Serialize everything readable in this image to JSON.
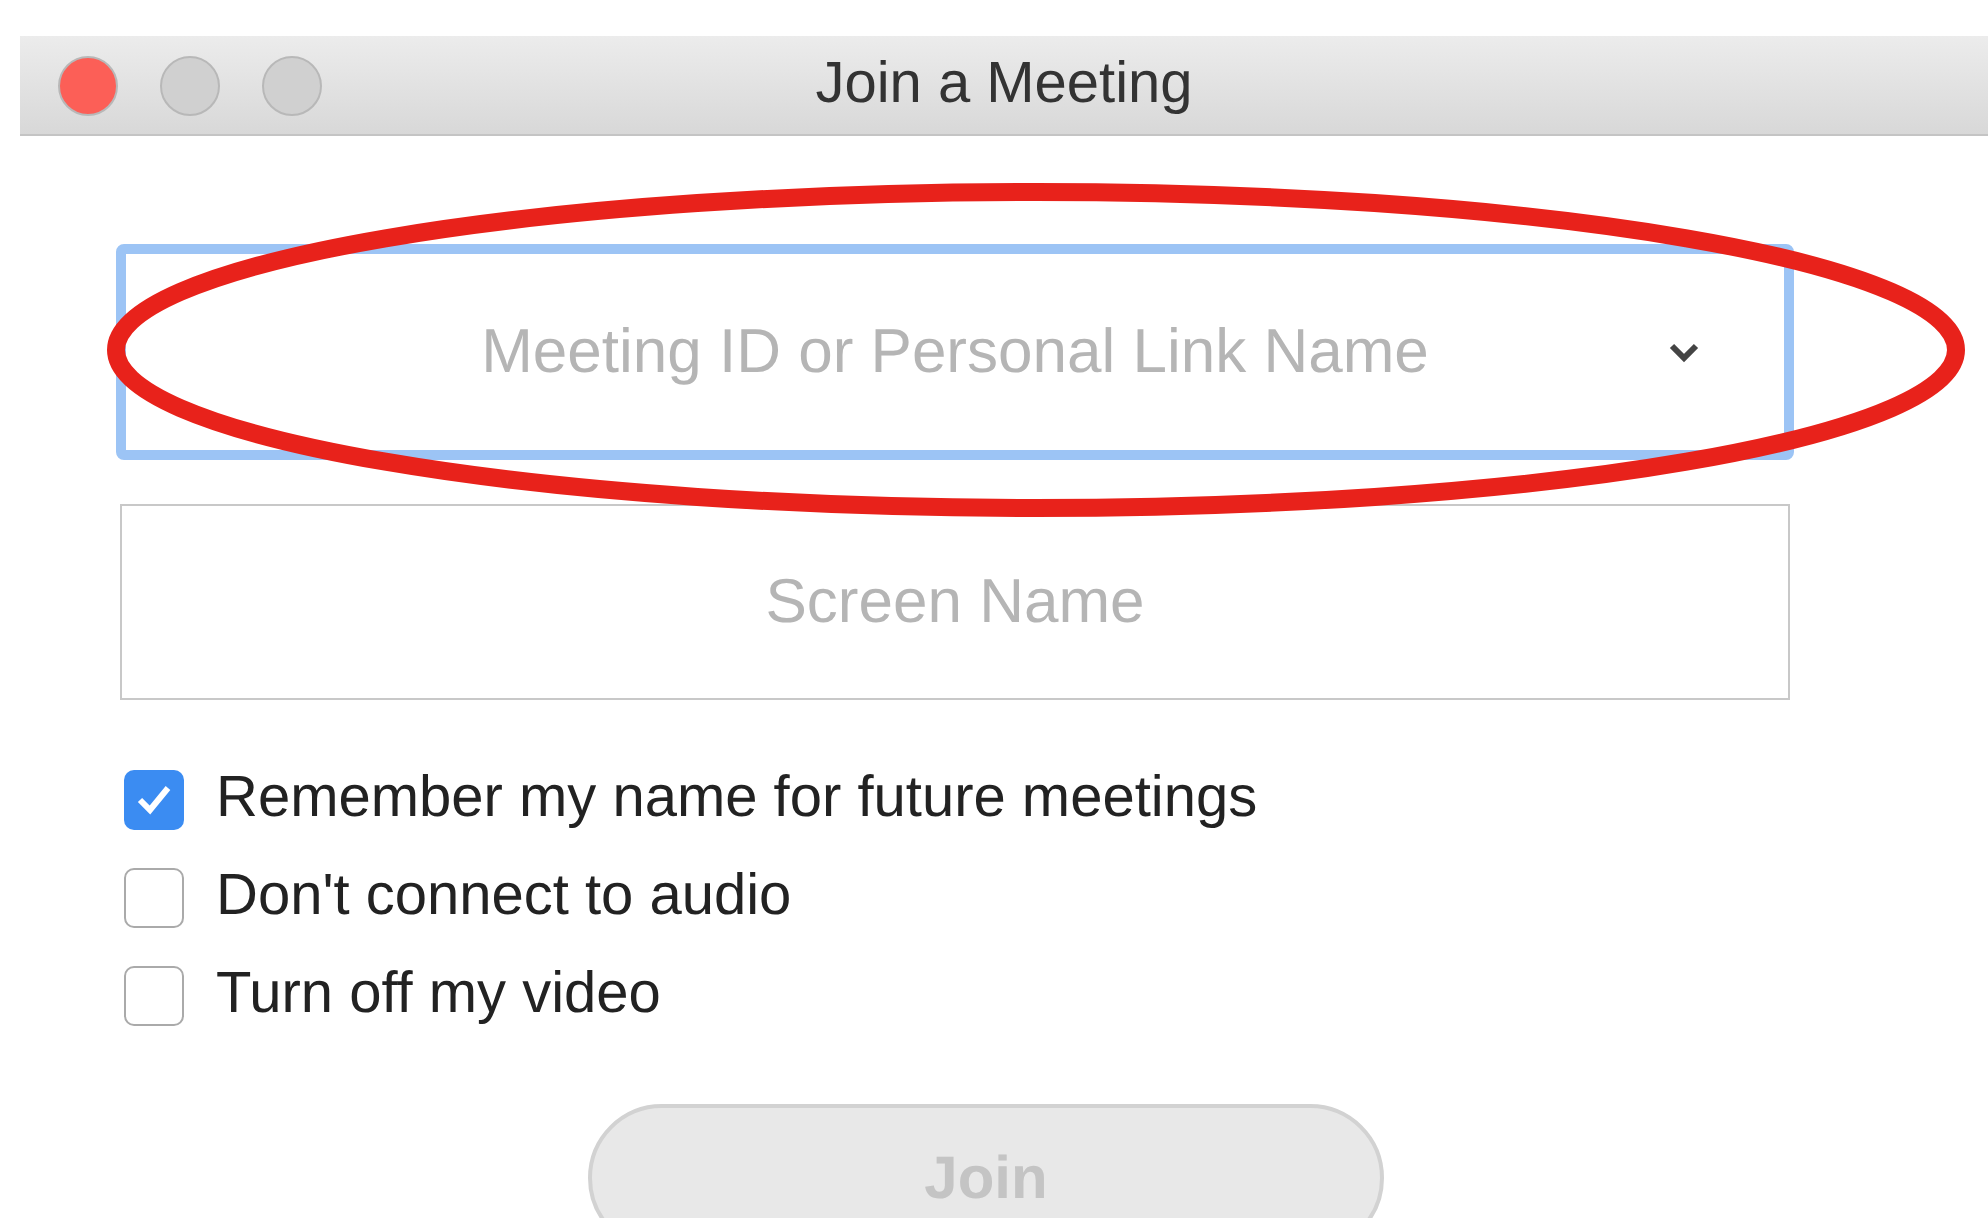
{
  "window": {
    "title": "Join a Meeting",
    "controls": [
      {
        "kind": "close",
        "active": true
      },
      {
        "kind": "minimize",
        "active": false
      },
      {
        "kind": "zoom",
        "active": false
      }
    ]
  },
  "fields": [
    {
      "kind": "combo",
      "placeholder": "Meeting ID or Personal Link Name",
      "focused": true
    },
    {
      "kind": "text",
      "placeholder": "Screen Name",
      "focused": false
    }
  ],
  "checkboxes": [
    {
      "label": "Remember my name for future meetings",
      "checked": true
    },
    {
      "label": "Don't connect to audio",
      "checked": false
    },
    {
      "label": "Turn off my video",
      "checked": false
    }
  ],
  "join_button": {
    "label": "Join",
    "disabled": true
  },
  "annotations": [
    {
      "kind": "ellipse"
    }
  ]
}
